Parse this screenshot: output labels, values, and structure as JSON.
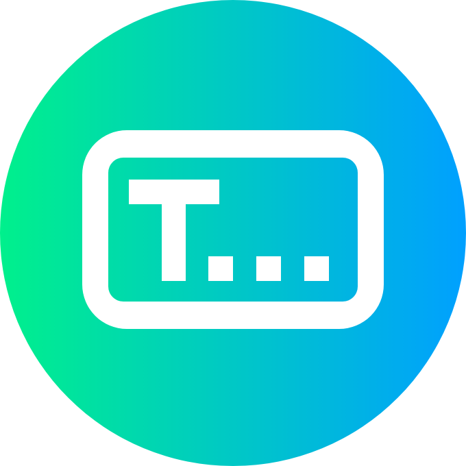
{
  "icon": {
    "name": "text-input-field-icon",
    "shape": "circle",
    "colors": {
      "gradient_start": "#00F08C",
      "gradient_end": "#00A0FF",
      "foreground": "#FFFFFF"
    }
  }
}
